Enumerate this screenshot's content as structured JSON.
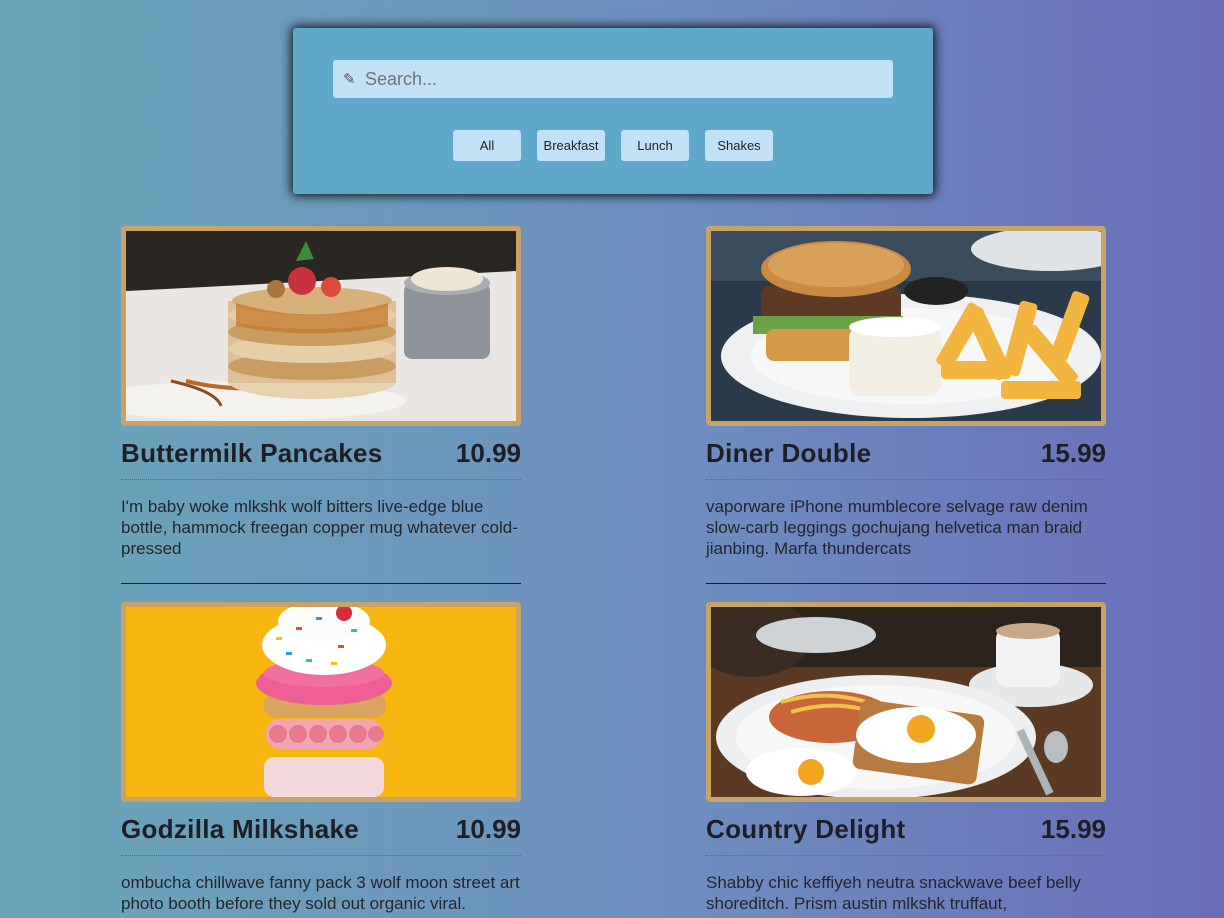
{
  "search": {
    "placeholder": "Search...",
    "icon": "pencil-icon"
  },
  "filters": [
    "All",
    "Breakfast",
    "Lunch",
    "Shakes"
  ],
  "colors": {
    "accent_border": "#c8a369",
    "panel": "#5fa8c8",
    "button": "#c2e1f6"
  },
  "items": [
    {
      "title": "Buttermilk Pancakes",
      "price": "10.99",
      "desc": "I'm baby woke mlkshk wolf bitters live-edge blue bottle, hammock freegan copper mug whatever cold-pressed",
      "image": "pancakes-photo"
    },
    {
      "title": "Diner Double",
      "price": "15.99",
      "desc": "vaporware iPhone mumblecore selvage raw denim slow-carb leggings gochujang helvetica man braid jianbing. Marfa thundercats",
      "image": "burger-fries-photo"
    },
    {
      "title": "Godzilla Milkshake",
      "price": "10.99",
      "desc": "ombucha chillwave fanny pack 3 wolf moon street art photo booth before they sold out organic viral.",
      "image": "milkshake-photo"
    },
    {
      "title": "Country Delight",
      "price": "15.99",
      "desc": "Shabby chic keffiyeh neutra snackwave beef belly shoreditch. Prism austin mlkshk truffaut,",
      "image": "breakfast-plate-photo"
    }
  ]
}
